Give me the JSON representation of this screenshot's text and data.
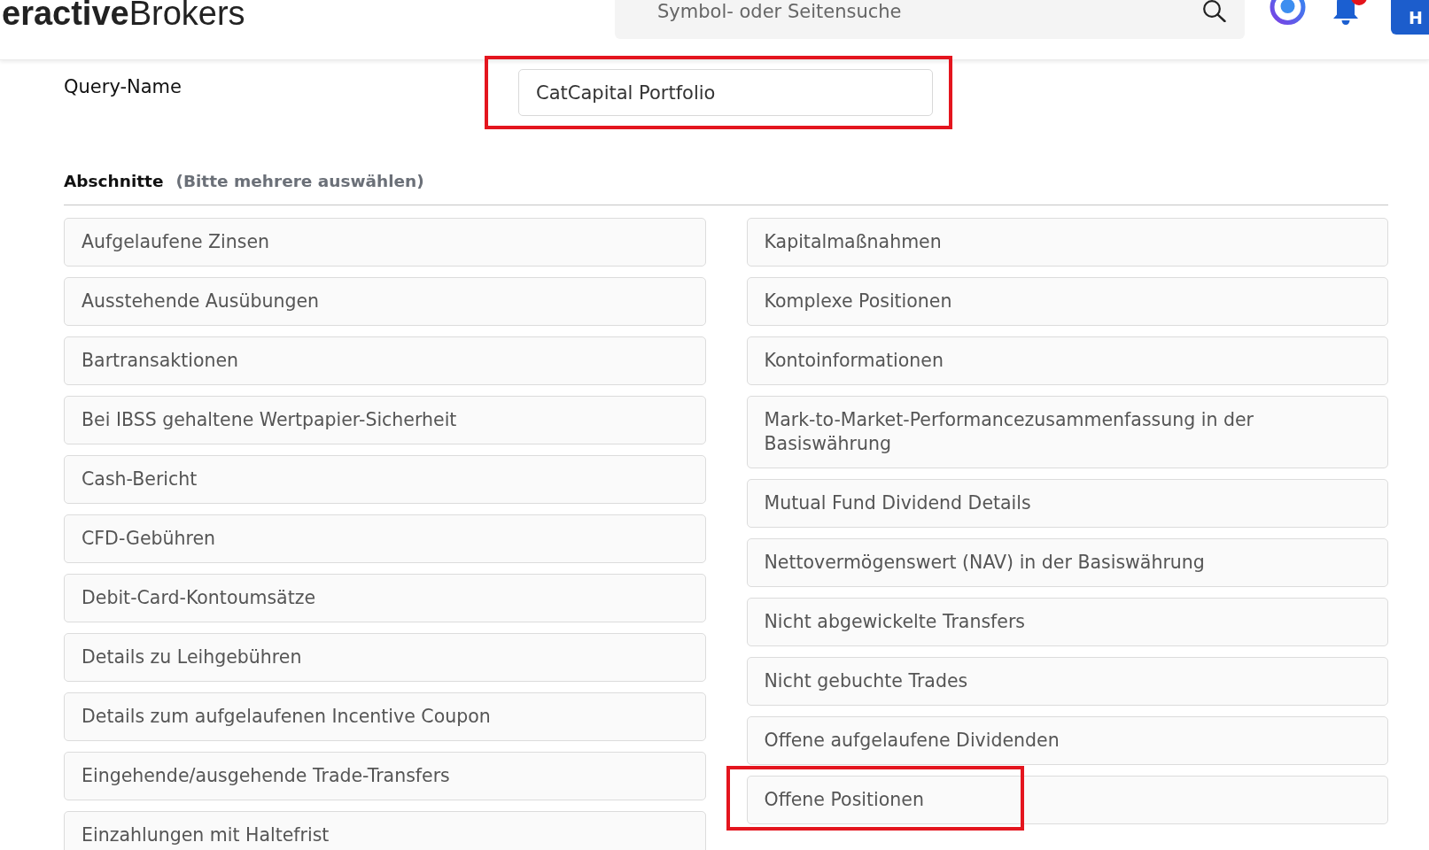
{
  "header": {
    "logo": "**eractive**Brokers",
    "search": {
      "placeholder": "Symbol- oder Seitensuche"
    },
    "notification_badge": true,
    "button": "H"
  },
  "query": {
    "label": "Query-Name",
    "value": "CatCapital Portfolio",
    "highlighted": true
  },
  "sections": {
    "title": "Abschnitte",
    "hint": "(Bitte mehrere auswählen)",
    "columns": [
      {
        "items": [
          {
            "label": "Aufgelaufene Zinsen",
            "selected": false,
            "highlighted": false
          },
          {
            "label": "Ausstehende Ausübungen",
            "selected": false,
            "highlighted": false
          },
          {
            "label": "Bartransaktionen",
            "selected": false,
            "highlighted": false
          },
          {
            "label": "Bei IBSS gehaltene Wertpapier-Sicherheit",
            "selected": false,
            "highlighted": false
          },
          {
            "label": "Cash-Bericht",
            "selected": false,
            "highlighted": false
          },
          {
            "label": "CFD-Gebühren",
            "selected": false,
            "highlighted": false
          },
          {
            "label": "Debit-Card-Kontoumsätze",
            "selected": false,
            "highlighted": false
          },
          {
            "label": "Details zu Leihgebühren",
            "selected": false,
            "highlighted": false
          },
          {
            "label": "Details zum aufgelaufenen Incentive Coupon",
            "selected": false,
            "highlighted": false
          },
          {
            "label": "Eingehende/ausgehende Trade-Transfers",
            "selected": false,
            "highlighted": false
          },
          {
            "label": "Einzahlungen mit Haltefrist",
            "selected": false,
            "highlighted": false
          }
        ]
      },
      {
        "items": [
          {
            "label": "Kapitalmaßnahmen",
            "selected": false,
            "highlighted": false
          },
          {
            "label": "Komplexe Positionen",
            "selected": false,
            "highlighted": false
          },
          {
            "label": "Kontoinformationen",
            "selected": false,
            "highlighted": false
          },
          {
            "label": "Mark-to-Market-Performancezusammenfassung in der Basiswährung",
            "selected": false,
            "highlighted": false
          },
          {
            "label": "Mutual Fund Dividend Details",
            "selected": false,
            "highlighted": false
          },
          {
            "label": "Nettovermögenswert (NAV) in der Basiswährung",
            "selected": false,
            "highlighted": false
          },
          {
            "label": "Nicht abgewickelte Transfers",
            "selected": false,
            "highlighted": false
          },
          {
            "label": "Nicht gebuchte Trades",
            "selected": false,
            "highlighted": false
          },
          {
            "label": "Offene aufgelaufene Dividenden",
            "selected": false,
            "highlighted": false
          },
          {
            "label": "Offene Positionen",
            "selected": false,
            "highlighted": true
          }
        ]
      }
    ]
  }
}
